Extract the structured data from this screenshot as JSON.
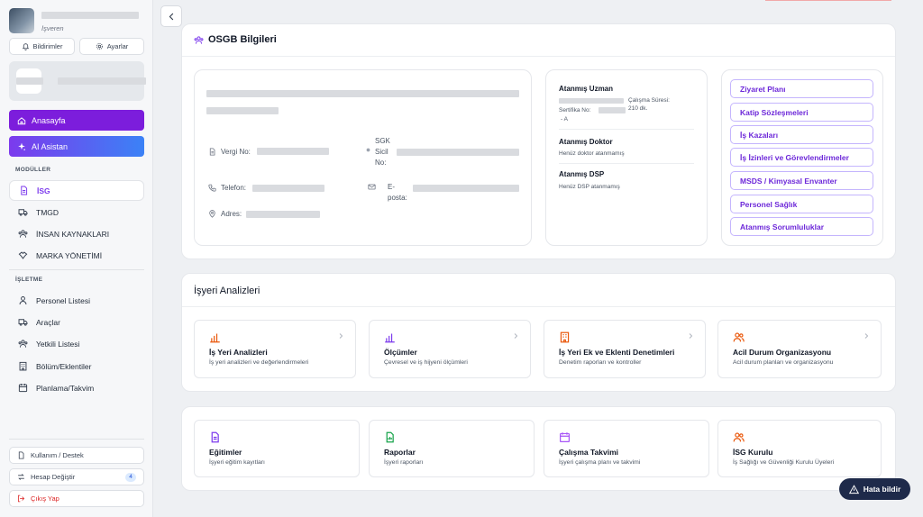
{
  "sidebar": {
    "user_role": "İşveren",
    "notifications_label": "Bildirimler",
    "settings_label": "Ayarlar",
    "home_label": "Anasayfa",
    "ai_label": "AI Asistan",
    "modules_label": "MODÜLLER",
    "modules": [
      "İSG",
      "TMGD",
      "İNSAN KAYNAKLARI",
      "MARKA YÖNETİMİ"
    ],
    "business_label": "İŞLETME",
    "business": [
      "Personel Listesi",
      "Araçlar",
      "Yetkili Listesi",
      "Bölüm/Eklentiler",
      "Planlama/Takvim"
    ],
    "usage_label": "Kullanım / Destek",
    "switch_label": "Hesap Değiştir",
    "switch_count": "4",
    "logout_label": "Çıkış Yap"
  },
  "osgb": {
    "title": "OSGB Bilgileri",
    "tax_label": "Vergi No:",
    "sgk_label": "SGK Sicil No:",
    "phone_label": "Telefon:",
    "email_label": "E-posta:",
    "address_label": "Adres:",
    "expert_title": "Atanmış Uzman",
    "expert_cert": "Sertifika No:",
    "expert_class": "- A",
    "expert_work_label": "Çalışma Süresi:",
    "expert_work_value": "210 dk.",
    "doctor_title": "Atanmış Doktor",
    "doctor_sub": "Henüz doktor atanmamış",
    "dsp_title": "Atanmış DSP",
    "dsp_sub": "Henüz DSP atanmamış",
    "quick_links": [
      "Ziyaret Planı",
      "Katip Sözleşmeleri",
      "İş Kazaları",
      "İş İzinleri ve Görevlendirmeler",
      "MSDS / Kimyasal Envanter",
      "Personel Sağlık",
      "Atanmış Sorumluluklar"
    ]
  },
  "analysis": {
    "title": "İşyeri Analizleri",
    "tiles": [
      {
        "title": "İş Yeri Analizleri",
        "sub": "İş yeri analizleri ve değerlendirmeleri"
      },
      {
        "title": "Ölçümler",
        "sub": "Çevresel ve iş hijyeni ölçümleri"
      },
      {
        "title": "İş Yeri Ek ve Eklenti Denetimleri",
        "sub": "Denetim raporları ve kontroller"
      },
      {
        "title": "Acil Durum Organizasyonu",
        "sub": "Acil durum planları ve organizasyonu"
      }
    ]
  },
  "bottom_tiles": [
    {
      "title": "Eğitimler",
      "sub": "İşyeri eğitim kayıtları"
    },
    {
      "title": "Raporlar",
      "sub": "İşyeri raporları"
    },
    {
      "title": "Çalışma Takvimi",
      "sub": "İşyeri çalışma planı ve takvimi"
    },
    {
      "title": "İSG Kurulu",
      "sub": "İş Sağlığı ve Güvenliği Kurulu Üyeleri"
    }
  ],
  "report_label": "Hata bildir",
  "colors": {
    "accent": "#7c3aed",
    "ai_gradient_start": "#7c3aed",
    "ai_gradient_end": "#3b82f6",
    "report_bg": "#1e2a4a"
  }
}
